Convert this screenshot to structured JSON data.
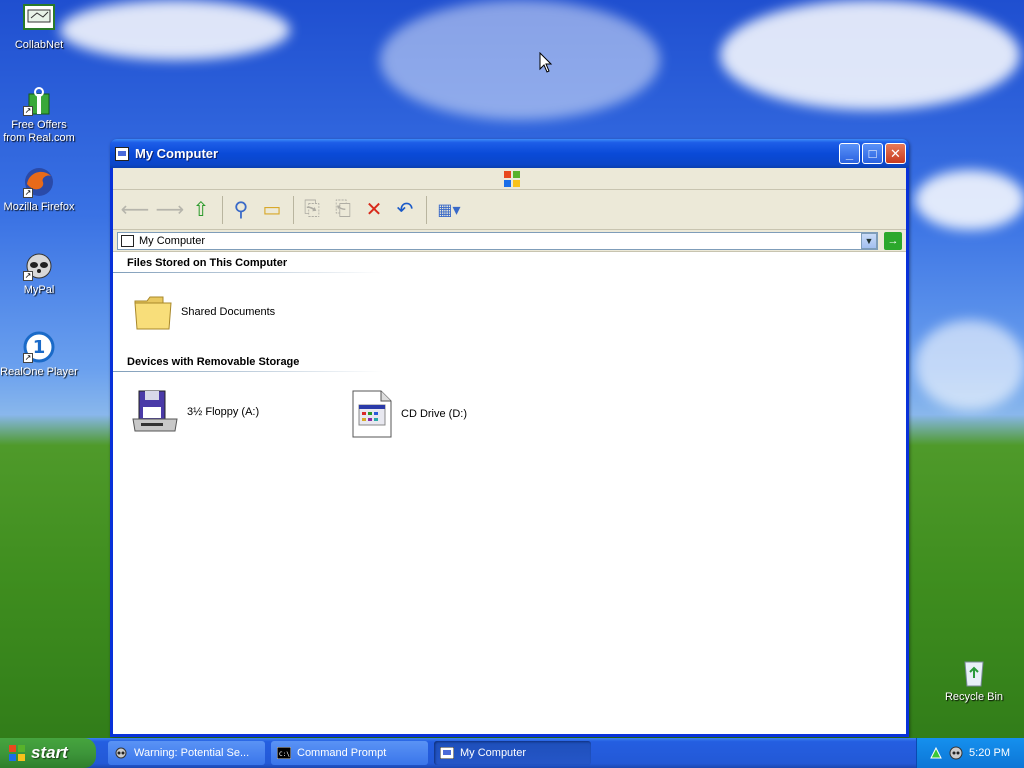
{
  "desktop": {
    "icons": [
      {
        "label": "CollabNet"
      },
      {
        "label": "Free Offers\nfrom Real.com"
      },
      {
        "label": "Mozilla Firefox"
      },
      {
        "label": "MyPal"
      },
      {
        "label": "RealOne Player"
      },
      {
        "label": "Recycle Bin"
      }
    ]
  },
  "window": {
    "title": "My Computer",
    "address": "My Computer",
    "groups": [
      {
        "heading": "Files Stored on This Computer",
        "items": [
          {
            "label": "Shared Documents",
            "icon": "folder-icon"
          }
        ]
      },
      {
        "heading": "Devices with Removable Storage",
        "items": [
          {
            "label": "3½ Floppy (A:)",
            "icon": "floppy-drive-icon"
          },
          {
            "label": "CD Drive (D:)",
            "icon": "cd-drive-icon"
          }
        ]
      }
    ]
  },
  "taskbar": {
    "start_label": "start",
    "tasks": [
      {
        "label": "Warning: Potential Se..."
      },
      {
        "label": "Command Prompt"
      },
      {
        "label": "My Computer"
      }
    ],
    "clock": "5:20 PM"
  },
  "colors": {
    "title_blue": "#0a4ad8",
    "taskbar_blue": "#245ee1",
    "start_green": "#3d963a"
  }
}
